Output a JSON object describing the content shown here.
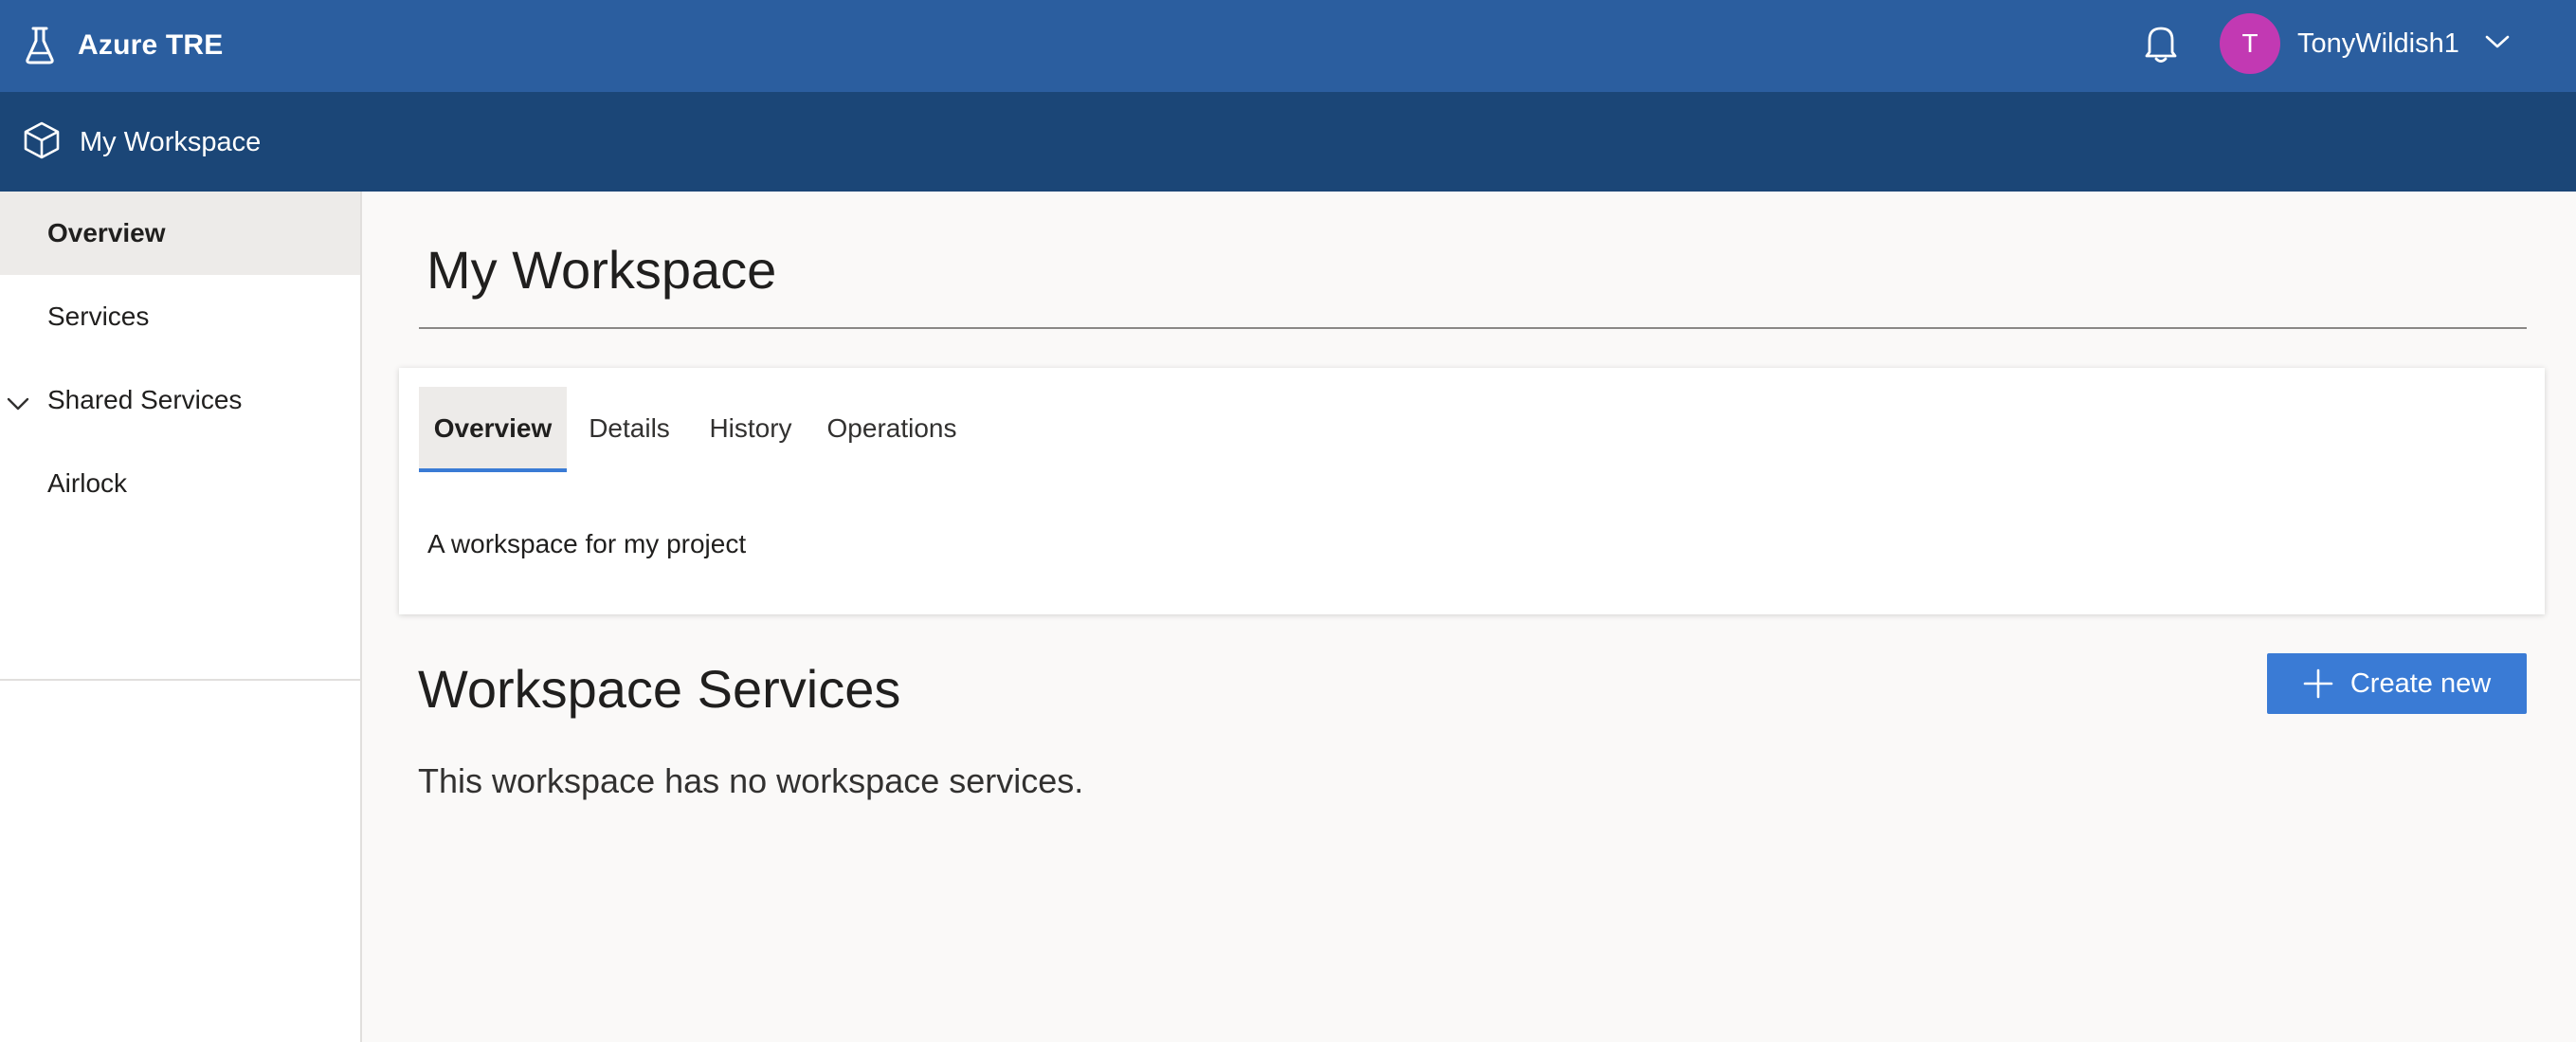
{
  "header": {
    "brand": "Azure TRE",
    "brand_icon": "flask-icon",
    "notification_icon": "bell-icon",
    "user": {
      "initial": "T",
      "name": "TonyWildish1",
      "avatar_color": "#c239b3"
    }
  },
  "workspace_bar": {
    "title": "My Workspace",
    "icon": "cube-icon"
  },
  "sidebar": {
    "items": [
      {
        "label": "Overview",
        "active": true
      },
      {
        "label": "Services"
      },
      {
        "label": "Shared Services",
        "expandable": true
      },
      {
        "label": "Airlock"
      }
    ]
  },
  "main": {
    "title": "My Workspace",
    "tabs": [
      {
        "label": "Overview",
        "active": true
      },
      {
        "label": "Details"
      },
      {
        "label": "History"
      },
      {
        "label": "Operations"
      }
    ],
    "description": "A workspace for my project",
    "services": {
      "title": "Workspace Services",
      "create_label": "Create new",
      "empty_message": "This workspace has no workspace services."
    }
  },
  "colors": {
    "top_bar": "#2b5e9f",
    "workspace_bar": "#1b4677",
    "accent": "#3a7bd5",
    "background": "#faf9f8"
  }
}
